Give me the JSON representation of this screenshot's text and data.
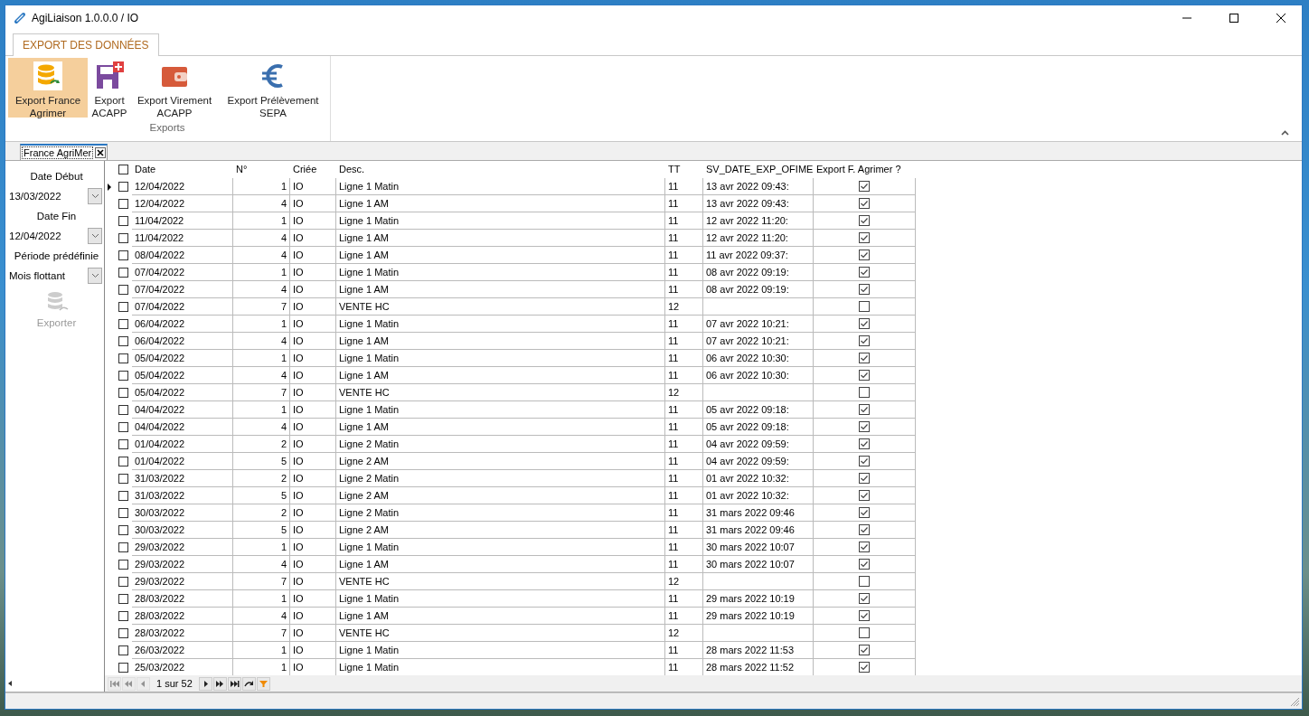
{
  "window": {
    "title": "AgiLiaison 1.0.0.0 / IO"
  },
  "ribbon": {
    "tabs": [
      {
        "label": "EXPORT DES DONNÉES",
        "selected": true
      }
    ],
    "buttons": [
      {
        "kind": "database",
        "label": "Export France Agrimer",
        "selected": true
      },
      {
        "kind": "floppy",
        "label": "Export ACAPP",
        "selected": false
      },
      {
        "kind": "wallet",
        "label": "Export Virement ACAPP",
        "selected": false
      },
      {
        "kind": "euro",
        "label": "Export Prélèvement SEPA",
        "selected": false
      }
    ],
    "group_label": "Exports"
  },
  "document_tab": {
    "label": "France AgriMer"
  },
  "filters": {
    "date_debut_label": "Date Début",
    "date_debut": "13/03/2022",
    "date_fin_label": "Date Fin",
    "date_fin": "12/04/2022",
    "periode_label": "Période prédéfinie",
    "periode": "Mois flottant",
    "export_button": {
      "label": "Exporter",
      "disabled": true
    }
  },
  "table": {
    "all_checked": false,
    "columns": [
      "Date",
      "N°",
      "Criée",
      "Desc.",
      "TT",
      "SV_DATE_EXP_OFIME",
      "Export F. Agrimer ?"
    ],
    "rows": [
      {
        "current": true,
        "checked": false,
        "date": "12/04/2022",
        "no": "1",
        "criee": "IO",
        "desc": "Ligne 1 Matin",
        "tt": "11",
        "sv_date": "13 avr 2022 09:43:",
        "exported": true
      },
      {
        "current": false,
        "checked": false,
        "date": "12/04/2022",
        "no": "4",
        "criee": "IO",
        "desc": "Ligne 1 AM",
        "tt": "11",
        "sv_date": "13 avr 2022 09:43:",
        "exported": true
      },
      {
        "current": false,
        "checked": false,
        "date": "11/04/2022",
        "no": "1",
        "criee": "IO",
        "desc": "Ligne 1 Matin",
        "tt": "11",
        "sv_date": "12 avr 2022 11:20:",
        "exported": true
      },
      {
        "current": false,
        "checked": false,
        "date": "11/04/2022",
        "no": "4",
        "criee": "IO",
        "desc": "Ligne 1 AM",
        "tt": "11",
        "sv_date": "12 avr 2022 11:20:",
        "exported": true
      },
      {
        "current": false,
        "checked": false,
        "date": "08/04/2022",
        "no": "4",
        "criee": "IO",
        "desc": "Ligne 1 AM",
        "tt": "11",
        "sv_date": "11 avr 2022 09:37:",
        "exported": true
      },
      {
        "current": false,
        "checked": false,
        "date": "07/04/2022",
        "no": "1",
        "criee": "IO",
        "desc": "Ligne 1 Matin",
        "tt": "11",
        "sv_date": "08 avr 2022 09:19:",
        "exported": true
      },
      {
        "current": false,
        "checked": false,
        "date": "07/04/2022",
        "no": "4",
        "criee": "IO",
        "desc": "Ligne 1 AM",
        "tt": "11",
        "sv_date": "08 avr 2022 09:19:",
        "exported": true
      },
      {
        "current": false,
        "checked": false,
        "date": "07/04/2022",
        "no": "7",
        "criee": "IO",
        "desc": "VENTE HC",
        "tt": "12",
        "exported": false
      },
      {
        "current": false,
        "checked": false,
        "date": "06/04/2022",
        "no": "1",
        "criee": "IO",
        "desc": "Ligne 1 Matin",
        "tt": "11",
        "sv_date": "07 avr 2022 10:21:",
        "exported": true
      },
      {
        "current": false,
        "checked": false,
        "date": "06/04/2022",
        "no": "4",
        "criee": "IO",
        "desc": "Ligne 1 AM",
        "tt": "11",
        "sv_date": "07 avr 2022 10:21:",
        "exported": true
      },
      {
        "current": false,
        "checked": false,
        "date": "05/04/2022",
        "no": "1",
        "criee": "IO",
        "desc": "Ligne 1 Matin",
        "tt": "11",
        "sv_date": "06 avr 2022 10:30:",
        "exported": true
      },
      {
        "current": false,
        "checked": false,
        "date": "05/04/2022",
        "no": "4",
        "criee": "IO",
        "desc": "Ligne 1 AM",
        "tt": "11",
        "sv_date": "06 avr 2022 10:30:",
        "exported": true
      },
      {
        "current": false,
        "checked": false,
        "date": "05/04/2022",
        "no": "7",
        "criee": "IO",
        "desc": "VENTE HC",
        "tt": "12",
        "exported": false
      },
      {
        "current": false,
        "checked": false,
        "date": "04/04/2022",
        "no": "1",
        "criee": "IO",
        "desc": "Ligne 1 Matin",
        "tt": "11",
        "sv_date": "05 avr 2022 09:18:",
        "exported": true
      },
      {
        "current": false,
        "checked": false,
        "date": "04/04/2022",
        "no": "4",
        "criee": "IO",
        "desc": "Ligne 1 AM",
        "tt": "11",
        "sv_date": "05 avr 2022 09:18:",
        "exported": true
      },
      {
        "current": false,
        "checked": false,
        "date": "01/04/2022",
        "no": "2",
        "criee": "IO",
        "desc": "Ligne 2 Matin",
        "tt": "11",
        "sv_date": "04 avr 2022 09:59:",
        "exported": true
      },
      {
        "current": false,
        "checked": false,
        "date": "01/04/2022",
        "no": "5",
        "criee": "IO",
        "desc": "Ligne 2 AM",
        "tt": "11",
        "sv_date": "04 avr 2022 09:59:",
        "exported": true
      },
      {
        "current": false,
        "checked": false,
        "date": "31/03/2022",
        "no": "2",
        "criee": "IO",
        "desc": "Ligne 2 Matin",
        "tt": "11",
        "sv_date": "01 avr 2022 10:32:",
        "exported": true
      },
      {
        "current": false,
        "checked": false,
        "date": "31/03/2022",
        "no": "5",
        "criee": "IO",
        "desc": "Ligne 2 AM",
        "tt": "11",
        "sv_date": "01 avr 2022 10:32:",
        "exported": true
      },
      {
        "current": false,
        "checked": false,
        "date": "30/03/2022",
        "no": "2",
        "criee": "IO",
        "desc": "Ligne 2 Matin",
        "tt": "11",
        "sv_date": "31 mars 2022 09:46",
        "exported": true
      },
      {
        "current": false,
        "checked": false,
        "date": "30/03/2022",
        "no": "5",
        "criee": "IO",
        "desc": "Ligne 2 AM",
        "tt": "11",
        "sv_date": "31 mars 2022 09:46",
        "exported": true
      },
      {
        "current": false,
        "checked": false,
        "date": "29/03/2022",
        "no": "1",
        "criee": "IO",
        "desc": "Ligne 1 Matin",
        "tt": "11",
        "sv_date": "30 mars 2022 10:07",
        "exported": true
      },
      {
        "current": false,
        "checked": false,
        "date": "29/03/2022",
        "no": "4",
        "criee": "IO",
        "desc": "Ligne 1 AM",
        "tt": "11",
        "sv_date": "30 mars 2022 10:07",
        "exported": true
      },
      {
        "current": false,
        "checked": false,
        "date": "29/03/2022",
        "no": "7",
        "criee": "IO",
        "desc": "VENTE HC",
        "tt": "12",
        "exported": false
      },
      {
        "current": false,
        "checked": false,
        "date": "28/03/2022",
        "no": "1",
        "criee": "IO",
        "desc": "Ligne 1 Matin",
        "tt": "11",
        "sv_date": "29 mars 2022 10:19",
        "exported": true
      },
      {
        "current": false,
        "checked": false,
        "date": "28/03/2022",
        "no": "4",
        "criee": "IO",
        "desc": "Ligne 1 AM",
        "tt": "11",
        "sv_date": "29 mars 2022 10:19",
        "exported": true
      },
      {
        "current": false,
        "checked": false,
        "date": "28/03/2022",
        "no": "7",
        "criee": "IO",
        "desc": "VENTE HC",
        "tt": "12",
        "exported": false
      },
      {
        "current": false,
        "checked": false,
        "date": "26/03/2022",
        "no": "1",
        "criee": "IO",
        "desc": "Ligne 1 Matin",
        "tt": "11",
        "sv_date": "28 mars 2022 11:53",
        "exported": true
      },
      {
        "current": false,
        "checked": false,
        "date": "25/03/2022",
        "no": "1",
        "criee": "IO",
        "desc": "Ligne 1 Matin",
        "tt": "11",
        "sv_date": "28 mars 2022 11:52",
        "exported": true
      }
    ]
  },
  "pager": {
    "text": "1 sur 52"
  }
}
